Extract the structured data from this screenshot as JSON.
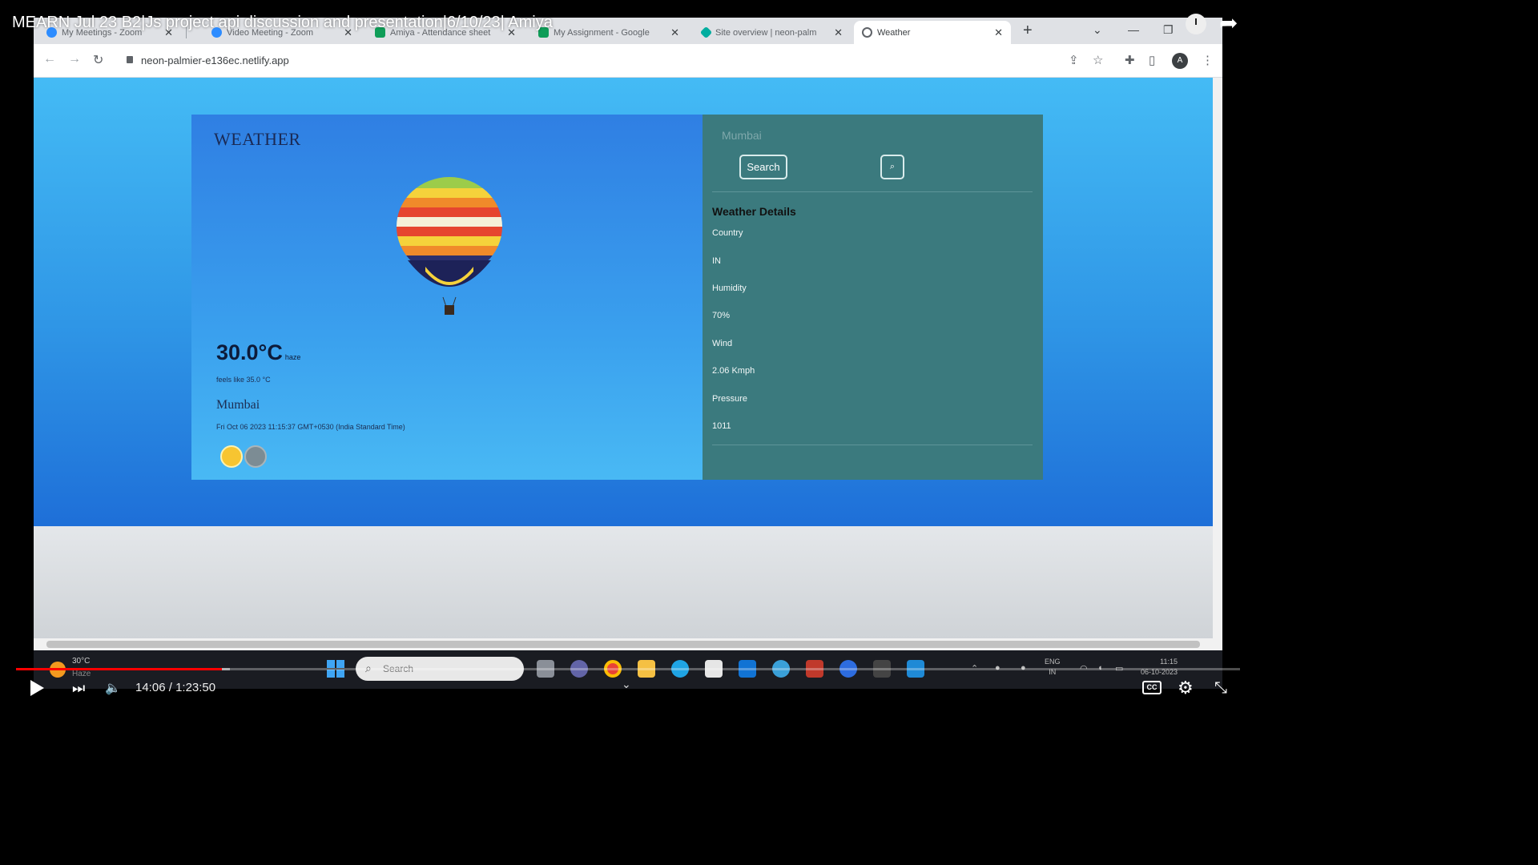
{
  "video": {
    "title": "MEARN Jul 23 B2|Js project api discussion and presentation|6/10/23| Amiya",
    "time_current": "14:06",
    "time_separator": "/",
    "time_total": "1:23:50",
    "progress": 0.168,
    "buffered": 0.175,
    "cc_label": "CC"
  },
  "browser": {
    "tabs": [
      {
        "label": "My Meetings - Zoom",
        "icon": "zoom-icon",
        "color": "#2d8cff"
      },
      {
        "label": "Video Meeting - Zoom",
        "icon": "zoom-icon",
        "color": "#2d8cff"
      },
      {
        "label": "Amiya - Attendance sheet",
        "icon": "sheets-icon",
        "color": "#0f9d58"
      },
      {
        "label": "My Assignment - Google",
        "icon": "sheets-icon",
        "color": "#0f9d58"
      },
      {
        "label": "Site overview | neon-palm",
        "icon": "netlify-icon",
        "color": "#00ad9f"
      },
      {
        "label": "Weather",
        "icon": "globe-icon",
        "color": "#5f6368"
      }
    ],
    "url": "neon-palmier-e136ec.netlify.app",
    "profile_initial": "A"
  },
  "weather": {
    "heading": "WEATHER",
    "temperature": "30.0°C",
    "condition": "haze",
    "feels_like": "feels like 35.0 °C",
    "city": "Mumbai",
    "datetime": "Fri Oct 06 2023 11:15:37 GMT+0530 (India Standard Time)",
    "search_value": "Mumbai",
    "search_button": "Search",
    "details_title": "Weather Details",
    "details": [
      {
        "label": "Country",
        "value": "IN"
      },
      {
        "label": "Humidity",
        "value": "70%"
      },
      {
        "label": "Wind",
        "value": "2.06 Kmph"
      },
      {
        "label": "Pressure",
        "value": "1011"
      }
    ]
  },
  "taskbar": {
    "weather_temp": "30°C",
    "weather_cond": "Haze",
    "search_placeholder": "Search",
    "lang_line1": "ENG",
    "lang_line2": "IN",
    "clock_time": "11:15",
    "clock_date": "06-10-2023"
  },
  "colors": {
    "progress": "#ff0000",
    "weather_panel": "#3b7a7e",
    "sky_top": "#44bbf5",
    "sky_bottom": "#1e6fd8"
  }
}
